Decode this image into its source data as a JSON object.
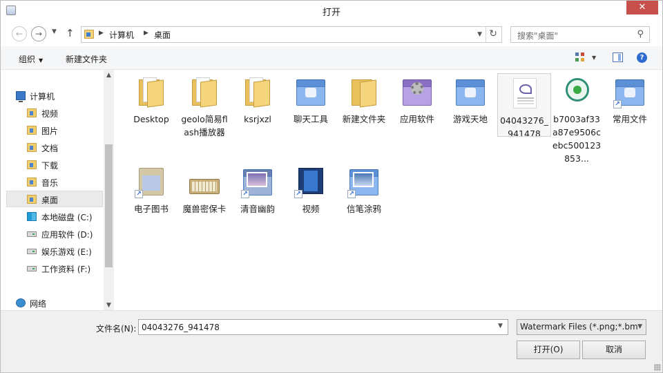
{
  "window": {
    "title": "打开",
    "close_symbol": "✕"
  },
  "nav": {
    "breadcrumbs": [
      "计算机",
      "桌面"
    ],
    "search_placeholder": "搜索\"桌面\""
  },
  "toolbar": {
    "organize_label": "组织",
    "new_folder_label": "新建文件夹"
  },
  "sidebar": {
    "items": [
      {
        "label": "计算机",
        "icon": "computer-icon"
      },
      {
        "label": "视频",
        "icon": "folder-icon"
      },
      {
        "label": "图片",
        "icon": "folder-icon"
      },
      {
        "label": "文档",
        "icon": "folder-icon"
      },
      {
        "label": "下载",
        "icon": "folder-icon"
      },
      {
        "label": "音乐",
        "icon": "folder-icon"
      },
      {
        "label": "桌面",
        "icon": "folder-icon",
        "selected": true
      },
      {
        "label": "本地磁盘 (C:)",
        "icon": "drive-icon"
      },
      {
        "label": "应用软件 (D:)",
        "icon": "drive-icon"
      },
      {
        "label": "娱乐游戏 (E:)",
        "icon": "drive-icon"
      },
      {
        "label": "工作资料 (F:)",
        "icon": "drive-icon"
      },
      {
        "label": "网络",
        "icon": "network-icon"
      }
    ]
  },
  "files": [
    {
      "label": "Desktop",
      "icon": "yellow-folder-icon"
    },
    {
      "label": "geolo简易flash播放器",
      "icon": "yellow-folder-icon"
    },
    {
      "label": "ksrjxzl",
      "icon": "yellow-folder-icon"
    },
    {
      "label": "聊天工具",
      "icon": "blue-folder-icon"
    },
    {
      "label": "新建文件夹",
      "icon": "yellow-folder-icon"
    },
    {
      "label": "应用软件",
      "icon": "purple-folder-icon"
    },
    {
      "label": "游戏天地",
      "icon": "blue-folder-icon"
    },
    {
      "label": "04043276_941478",
      "icon": "image-thumbnail-icon",
      "selected": true
    },
    {
      "label": "b7003af33a87e9506cebc500123853...",
      "icon": "image-thumbnail-icon"
    },
    {
      "label": "常用文件",
      "icon": "shortcut-folder-icon"
    },
    {
      "label": "电子图书",
      "icon": "ebook-shortcut-icon"
    },
    {
      "label": "魔兽密保卡",
      "icon": "keyboard-image-icon"
    },
    {
      "label": "清音幽韵",
      "icon": "music-shortcut-icon"
    },
    {
      "label": "视频",
      "icon": "video-shortcut-icon"
    },
    {
      "label": "信笔涂鸦",
      "icon": "picture-shortcut-icon"
    }
  ],
  "bottom": {
    "filename_label": "文件名(N):",
    "filename_value": "04043276_941478",
    "filter_value": "Watermark Files (*.png;*.bm",
    "open_label": "打开(O)",
    "cancel_label": "取消"
  }
}
